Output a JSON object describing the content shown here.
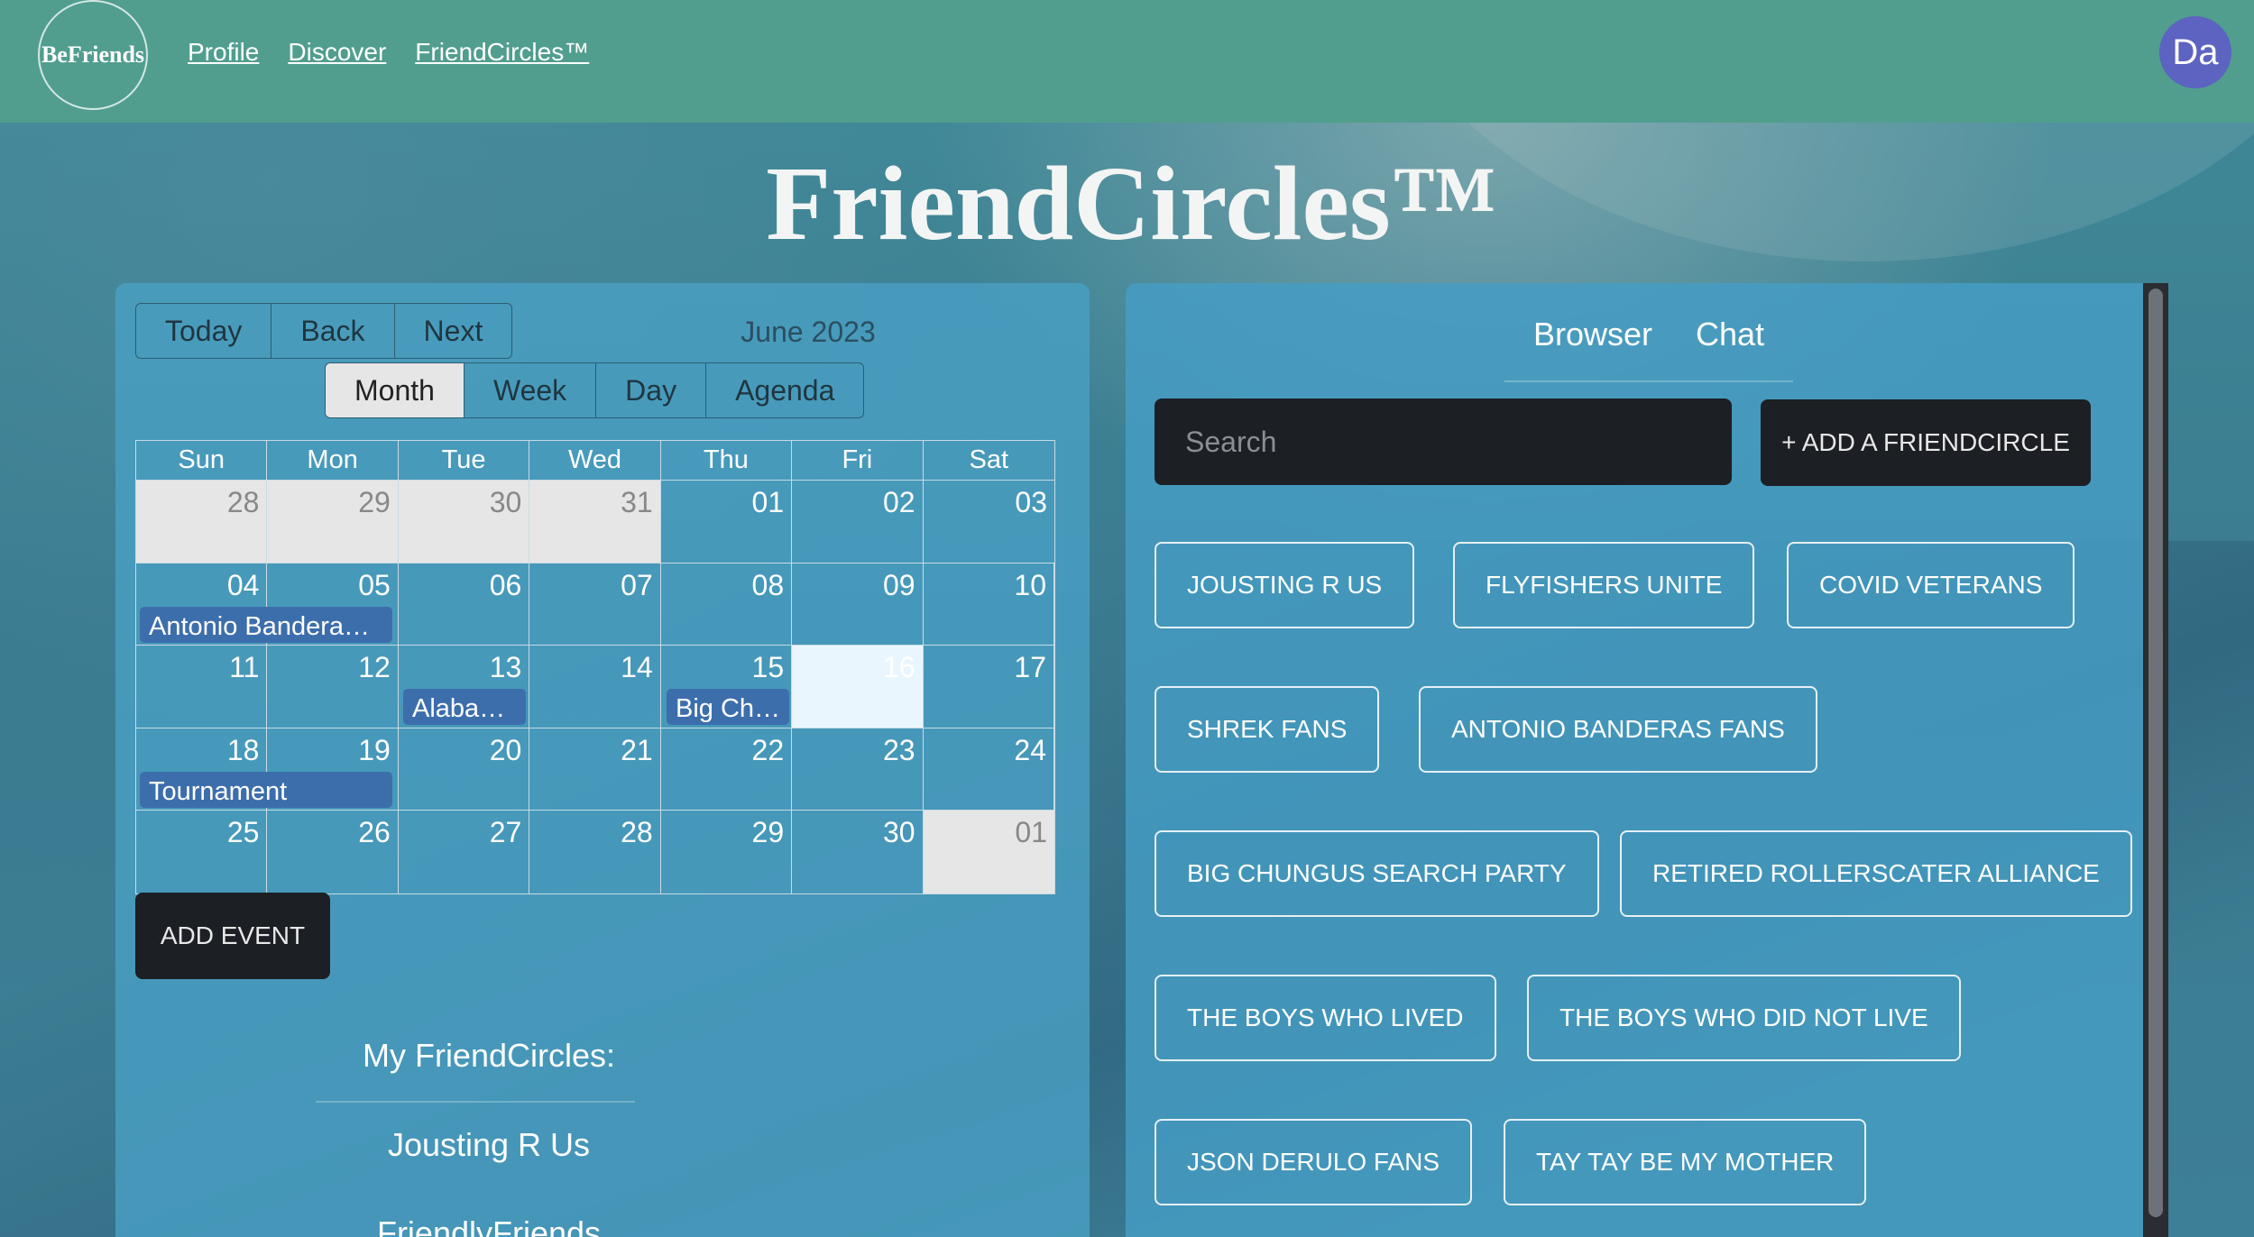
{
  "header": {
    "logo": "BeFriends",
    "nav": [
      "Profile",
      "Discover",
      "FriendCircles™"
    ],
    "avatar": "Da"
  },
  "page_title": "FriendCircles™",
  "calendar": {
    "nav_buttons": [
      "Today",
      "Back",
      "Next"
    ],
    "views": [
      "Month",
      "Week",
      "Day",
      "Agenda"
    ],
    "active_view": "Month",
    "month_label": "June 2023",
    "weekdays": [
      "Sun",
      "Mon",
      "Tue",
      "Wed",
      "Thu",
      "Fri",
      "Sat"
    ],
    "weeks": [
      [
        "28",
        "29",
        "30",
        "31",
        "01",
        "02",
        "03"
      ],
      [
        "04",
        "05",
        "06",
        "07",
        "08",
        "09",
        "10"
      ],
      [
        "11",
        "12",
        "13",
        "14",
        "15",
        "16",
        "17"
      ],
      [
        "18",
        "19",
        "20",
        "21",
        "22",
        "23",
        "24"
      ],
      [
        "25",
        "26",
        "27",
        "28",
        "29",
        "30",
        "01"
      ]
    ],
    "events": [
      {
        "label": "Antonio Bandera…"
      },
      {
        "label": "Alaba…"
      },
      {
        "label": "Big Ch…"
      },
      {
        "label": "Tournament"
      }
    ],
    "add_event": "ADD EVENT"
  },
  "my_circles": {
    "title": "My FriendCircles:",
    "items": [
      "Jousting R Us",
      "FriendlyFriends"
    ]
  },
  "browser": {
    "tabs": [
      "Browser",
      "Chat"
    ],
    "search_placeholder": "Search",
    "add_button": "+ ADD A FRIENDCIRCLE",
    "circles": [
      "JOUSTING R US",
      "FLYFISHERS UNITE",
      "COVID VETERANS",
      "SHREK FANS",
      "ANTONIO BANDERAS FANS",
      "BIG CHUNGUS SEARCH PARTY",
      "RETIRED ROLLERSCATER ALLIANCE",
      "THE BOYS WHO LIVED",
      "THE BOYS WHO DID NOT LIVE",
      "JSON DERULO FANS",
      "TAY TAY BE MY MOTHER"
    ]
  }
}
